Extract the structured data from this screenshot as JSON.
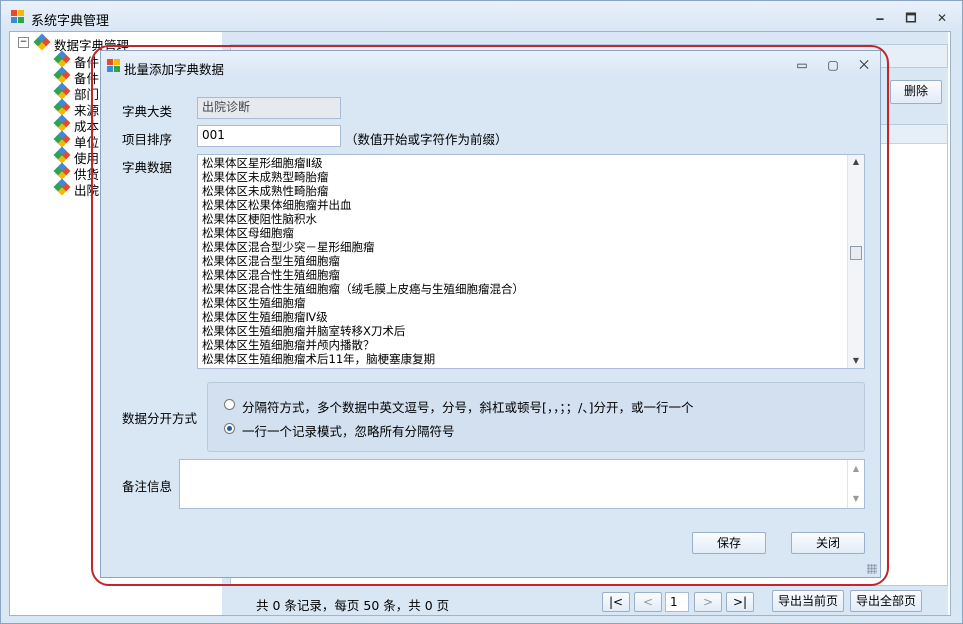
{
  "app": {
    "title": "系统字典管理",
    "controls": {
      "minimize": "🗕",
      "maximize": "🗖",
      "close": "✕"
    }
  },
  "tree": {
    "root": {
      "label": "数据字典管理",
      "expander": "−"
    },
    "items": [
      {
        "label": "备件"
      },
      {
        "label": "备件"
      },
      {
        "label": "部门"
      },
      {
        "label": "来源"
      },
      {
        "label": "成本"
      },
      {
        "label": "单位"
      },
      {
        "label": "使用"
      },
      {
        "label": "供货"
      },
      {
        "label": "出院"
      }
    ]
  },
  "right_panel": {
    "delete_button": "删除"
  },
  "pager": {
    "summary": "共 0 条记录，每页 50 条，共 0 页",
    "first": "|<",
    "prev": "<",
    "page": "1",
    "next": ">",
    "last": ">|",
    "export_current": "导出当前页",
    "export_all": "导出全部页"
  },
  "dialog": {
    "title": "批量添加字典数据",
    "controls": {
      "minimize": "▭",
      "maximize": "▢",
      "close": "⨉"
    },
    "category_label": "字典大类",
    "category_value": "出院诊断",
    "order_label": "项目排序",
    "order_value": "001",
    "order_hint": "（数值开始或字符作为前缀）",
    "data_label": "字典数据",
    "data_lines": [
      "松果体区星形细胞瘤Ⅱ级",
      "松果体区未成熟型畸胎瘤",
      "松果体区未成熟性畸胎瘤",
      "松果体区松果体细胞瘤并出血",
      "松果体区梗阻性脑积水",
      "松果体区母细胞瘤",
      "松果体区混合型少突－星形细胞瘤",
      "松果体区混合型生殖细胞瘤",
      "松果体区混合性生殖细胞瘤",
      "松果体区混合性生殖细胞瘤（绒毛膜上皮癌与生殖细胞瘤混合）",
      "松果体区生殖细胞瘤",
      "松果体区生殖细胞瘤Ⅳ级",
      "松果体区生殖细胞瘤并脑室转移X刀术后",
      "松果体区生殖细胞瘤并颅内播散？",
      "松果体区生殖细胞瘤术后11年，脑梗塞康复期"
    ],
    "scroll_position": 0.45,
    "split_label": "数据分开方式",
    "split_option_1": "分隔符方式，多个数据中英文逗号，分号，斜杠或顿号[，，；；/、]分开，或一行一个",
    "split_option_2": "一行一个记录模式，忽略所有分隔符号",
    "selected_option": 2,
    "remark_label": "备注信息",
    "save_button": "保存",
    "close_button": "关闭"
  }
}
